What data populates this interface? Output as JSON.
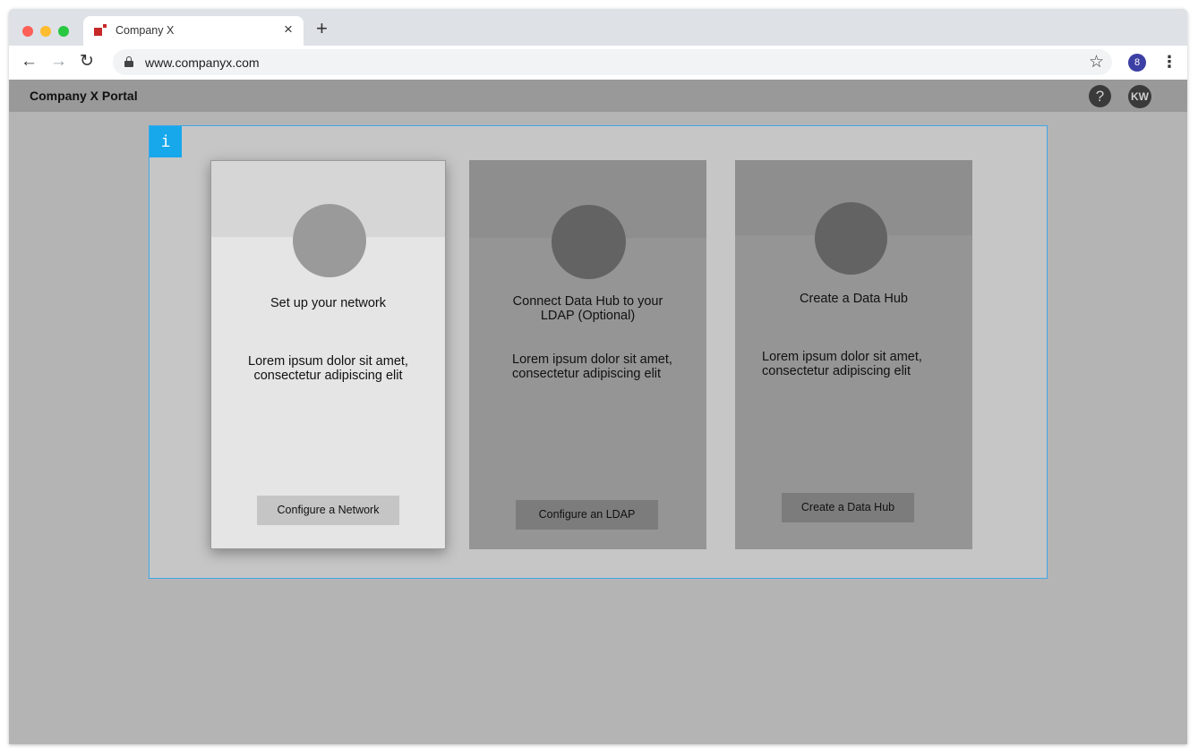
{
  "browser": {
    "tab_title": "Company X",
    "tab_close_glyph": "×",
    "new_tab_glyph": "+",
    "url": "www.companyx.com",
    "back_glyph": "←",
    "forward_glyph": "→",
    "reload_glyph": "↻",
    "star_glyph": "☆",
    "profile_glyph": "8",
    "menu_glyph": "⋮",
    "icons": [
      "back-icon",
      "forward-icon",
      "reload-icon",
      "lock-icon",
      "star-icon",
      "profile-icon",
      "menu-icon"
    ]
  },
  "header": {
    "title": "Company X Portal",
    "help_glyph": "?",
    "avatar_initials": "KW"
  },
  "info_badge": "i",
  "cards": [
    {
      "heading": "Set up your network",
      "body_line1": "Lorem ipsum dolor sit amet,",
      "body_line2": "consectetur adipiscing elit",
      "button": "Configure a Network",
      "active": true
    },
    {
      "heading_line1": "Connect Data Hub to your",
      "heading_line2": "LDAP (Optional)",
      "body_line1": "Lorem ipsum dolor sit amet,",
      "body_line2": "consectetur adipiscing elit",
      "button": "Configure an LDAP",
      "active": false
    },
    {
      "heading": "Create a Data Hub",
      "body_line1": "Lorem ipsum dolor sit amet,",
      "body_line2": "consectetur adipiscing elit",
      "button": "Create a Data Hub",
      "active": false
    }
  ],
  "colors": {
    "selection_border": "#3fa7e8",
    "info_badge": "#17a8ec",
    "favicon": "#c62828",
    "profile": "#3c3fa3"
  }
}
